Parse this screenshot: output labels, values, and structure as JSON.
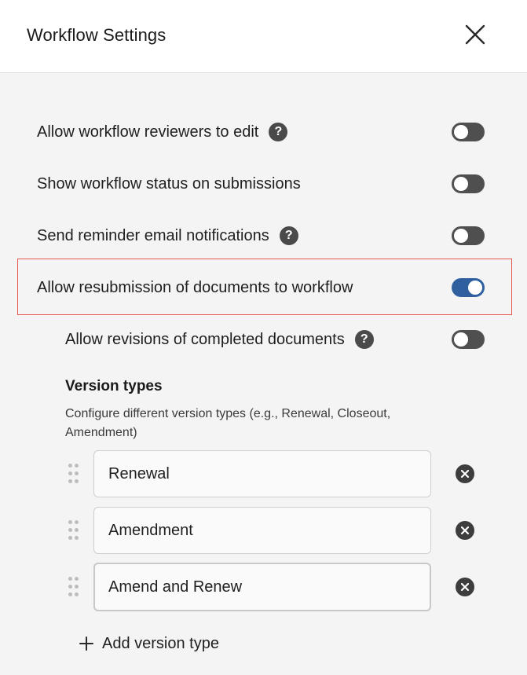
{
  "header": {
    "title": "Workflow Settings",
    "close_icon": "close-icon"
  },
  "settings": [
    {
      "label": "Allow workflow reviewers to edit",
      "has_help": true,
      "enabled": false
    },
    {
      "label": "Show workflow status on submissions",
      "has_help": false,
      "enabled": false
    },
    {
      "label": "Send reminder email notifications",
      "has_help": true,
      "enabled": false
    },
    {
      "label": "Allow resubmission of documents to workflow",
      "has_help": false,
      "enabled": true,
      "highlighted": true
    },
    {
      "label": "Allow revisions of completed documents",
      "has_help": true,
      "enabled": false
    }
  ],
  "help_glyph": "?",
  "version_types": {
    "title": "Version types",
    "description": "Configure different version types (e.g., Renewal, Closeout, Amendment)",
    "items": [
      {
        "value": "Renewal"
      },
      {
        "value": "Amendment"
      },
      {
        "value": "Amend and Renew"
      }
    ],
    "add_label": "Add version type"
  },
  "colors": {
    "toggle_on": "#2f5f9e",
    "toggle_off": "#4f4f4f",
    "highlight_border": "#e8554e"
  }
}
